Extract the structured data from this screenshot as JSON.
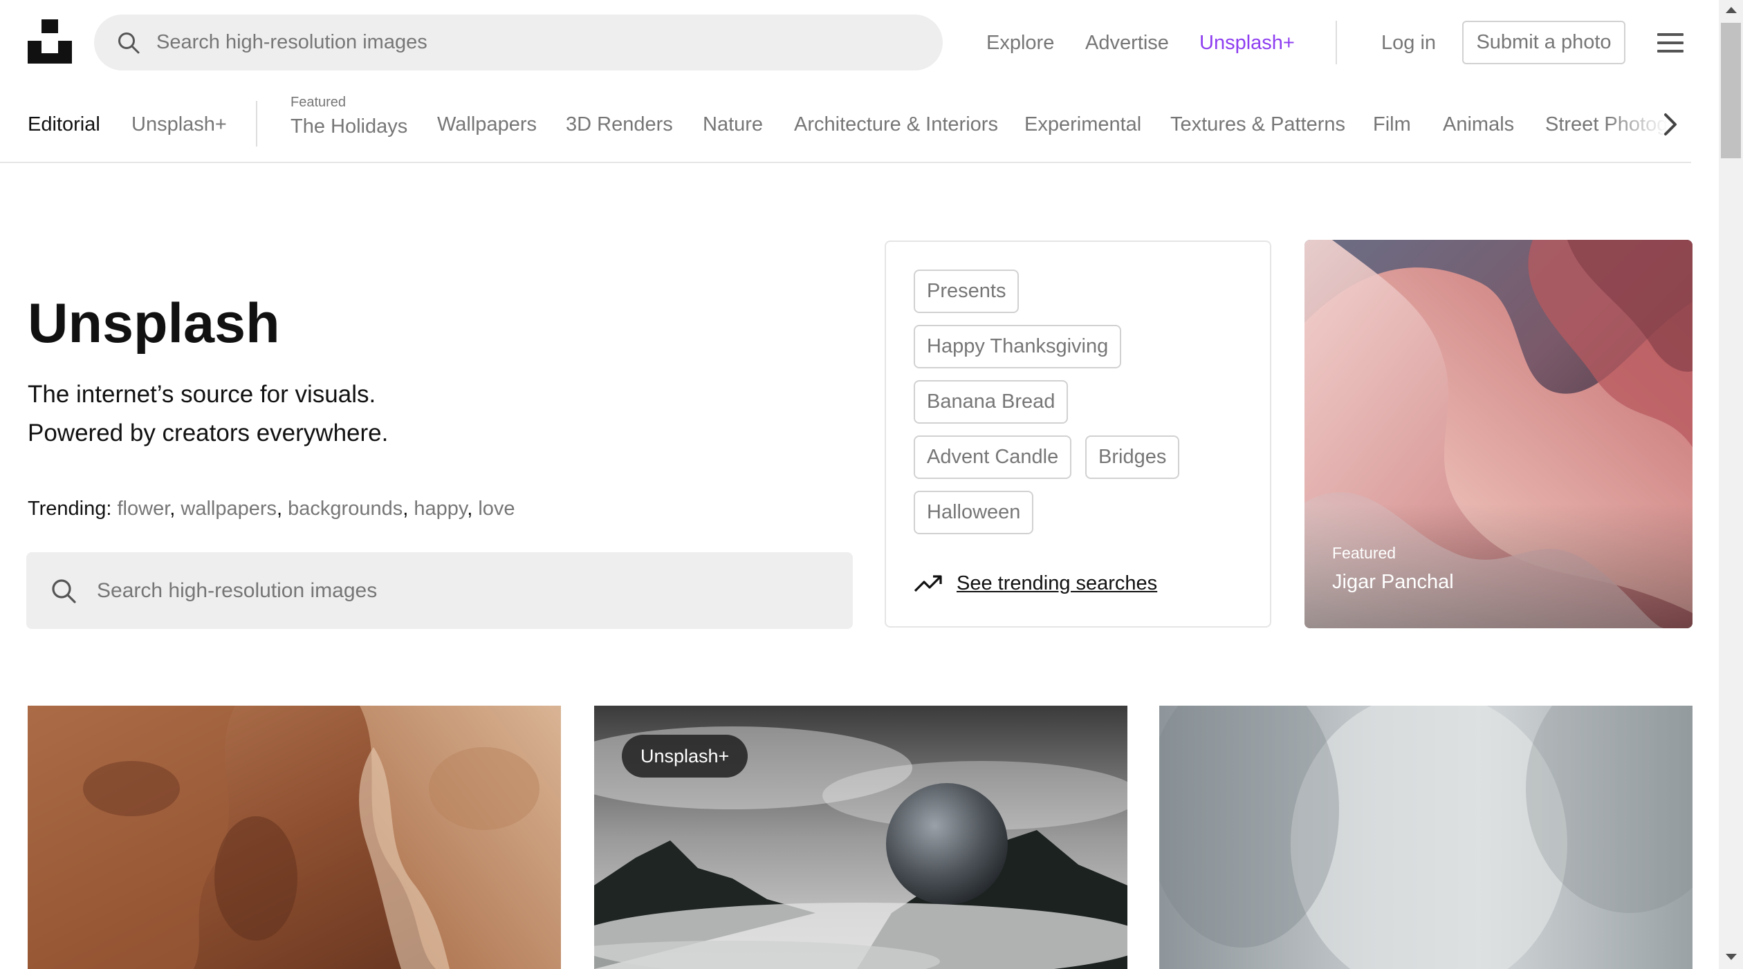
{
  "header": {
    "search_placeholder": "Search high-resolution images",
    "nav": [
      "Explore",
      "Advertise",
      "Unsplash+"
    ],
    "login": "Log in",
    "submit": "Submit a photo"
  },
  "categories": {
    "editorial": "Editorial",
    "unsplash_plus": "Unsplash+",
    "featured_label": "Featured",
    "items": [
      "The Holidays",
      "Wallpapers",
      "3D Renders",
      "Nature",
      "Architecture & Interiors",
      "Experimental",
      "Textures & Patterns",
      "Film",
      "Animals",
      "Street Photography"
    ]
  },
  "hero": {
    "title": "Unsplash",
    "subtitle_line1": "The internet’s source for visuals.",
    "subtitle_line2": "Powered by creators everywhere.",
    "trending_label": "Trending:",
    "trending_terms": [
      "flower",
      "wallpapers",
      "backgrounds",
      "happy",
      "love"
    ],
    "search_placeholder": "Search high-resolution images"
  },
  "trend_card": {
    "chips": [
      "Presents",
      "Happy Thanksgiving",
      "Banana Bread",
      "Advent Candle",
      "Bridges",
      "Halloween"
    ],
    "link": "See trending searches"
  },
  "featured_photo": {
    "label": "Featured",
    "photographer": "Jigar Panchal"
  },
  "grid": {
    "badge": "Unsplash+"
  },
  "colors": {
    "accent_purple": "#8e3ef0",
    "text_muted": "#767676",
    "search_bg": "#eeeeee"
  }
}
